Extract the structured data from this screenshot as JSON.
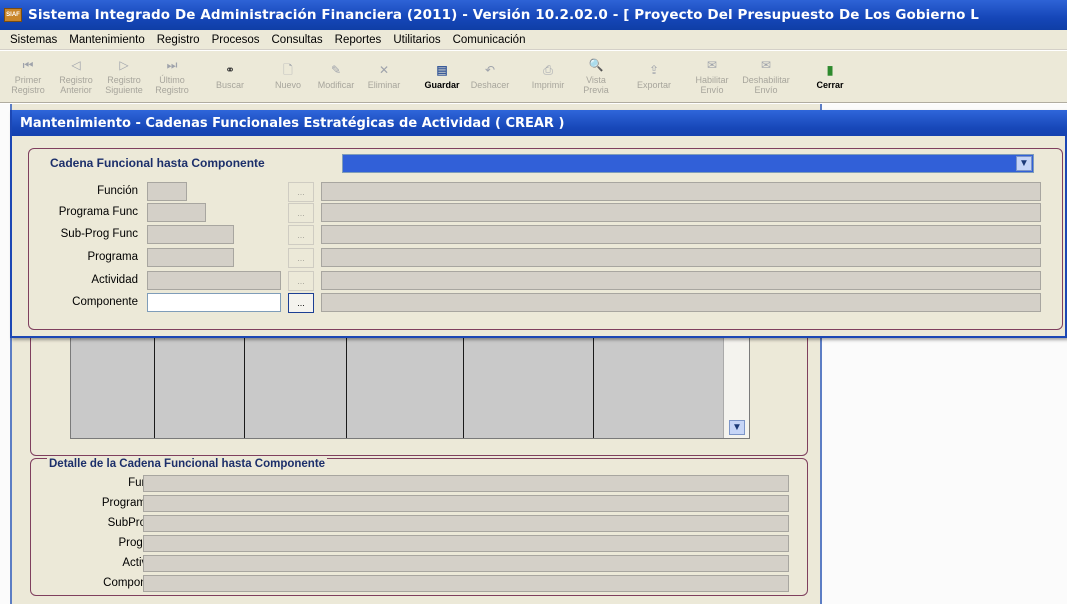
{
  "window": {
    "app_icon_text": "SIAF",
    "title": "Sistema Integrado De Administración Financiera (2011) - Versión 10.2.02.0 - [ Proyecto Del Presupuesto De Los Gobierno L"
  },
  "menu": {
    "items": [
      {
        "label": "Sistemas"
      },
      {
        "label": "Mantenimiento"
      },
      {
        "label": "Registro"
      },
      {
        "label": "Procesos"
      },
      {
        "label": "Consultas"
      },
      {
        "label": "Reportes"
      },
      {
        "label": "Utilitarios"
      },
      {
        "label": "Comunicación"
      }
    ]
  },
  "toolbar": {
    "buttons": [
      {
        "line1": "Primer",
        "line2": "Registro",
        "icon": "first-record-icon",
        "glyph": "⏮"
      },
      {
        "line1": "Registro",
        "line2": "Anterior",
        "icon": "previous-record-icon",
        "glyph": "◁"
      },
      {
        "line1": "Registro",
        "line2": "Siguiente",
        "icon": "next-record-icon",
        "glyph": "▷"
      },
      {
        "line1": "Último",
        "line2": "Registro",
        "icon": "last-record-icon",
        "glyph": "⏭"
      },
      {
        "line1": "",
        "line2": "Buscar",
        "icon": "binoculars-icon",
        "glyph": "⚭"
      },
      {
        "line1": "",
        "line2": "Nuevo",
        "icon": "new-document-icon",
        "glyph": "🗋"
      },
      {
        "line1": "",
        "line2": "Modificar",
        "icon": "edit-icon",
        "glyph": "✎"
      },
      {
        "line1": "",
        "line2": "Eliminar",
        "icon": "delete-icon",
        "glyph": "✕"
      },
      {
        "line1": "",
        "line2": "Guardar",
        "icon": "save-icon",
        "glyph": "▤"
      },
      {
        "line1": "",
        "line2": "Deshacer",
        "icon": "undo-icon",
        "glyph": "↶"
      },
      {
        "line1": "",
        "line2": "Imprimir",
        "icon": "print-icon",
        "glyph": "⎙"
      },
      {
        "line1": "Vista",
        "line2": "Previa",
        "icon": "preview-icon",
        "glyph": "🔍"
      },
      {
        "line1": "",
        "line2": "Exportar",
        "icon": "export-icon",
        "glyph": "⇪"
      },
      {
        "line1": "Habilitar",
        "line2": "Envío",
        "icon": "enable-send-icon",
        "glyph": "✉"
      },
      {
        "line1": "Deshabilitar",
        "line2": "Envío",
        "icon": "disable-send-icon",
        "glyph": "✉"
      },
      {
        "line1": "",
        "line2": "Cerrar",
        "icon": "close-door-icon",
        "glyph": "▮"
      }
    ]
  },
  "dialog": {
    "title": "Mantenimiento - Cadenas Funcionales Estratégicas de Actividad ( CREAR )",
    "cadena_label": "Cadena Funcional hasta Componente",
    "combo_value": "",
    "ellipsis": "...",
    "fields": [
      {
        "label": "Función"
      },
      {
        "label": "Programa Func"
      },
      {
        "label": "Sub-Prog Func"
      },
      {
        "label": "Programa"
      },
      {
        "label": "Actividad"
      },
      {
        "label": "Componente"
      }
    ]
  },
  "detail": {
    "legend": "Detalle de la Cadena Funcional hasta Componente",
    "fields": [
      {
        "label": "Función"
      },
      {
        "label": "Programa Fn"
      },
      {
        "label": "SubProg Fn"
      },
      {
        "label": "Programa"
      },
      {
        "label": "Actividad"
      },
      {
        "label": "Componente"
      }
    ]
  },
  "colors": {
    "titlebar": "#1546b8",
    "face": "#ece9d8",
    "selection": "#3160d8",
    "group_border": "#7f3f5e"
  }
}
